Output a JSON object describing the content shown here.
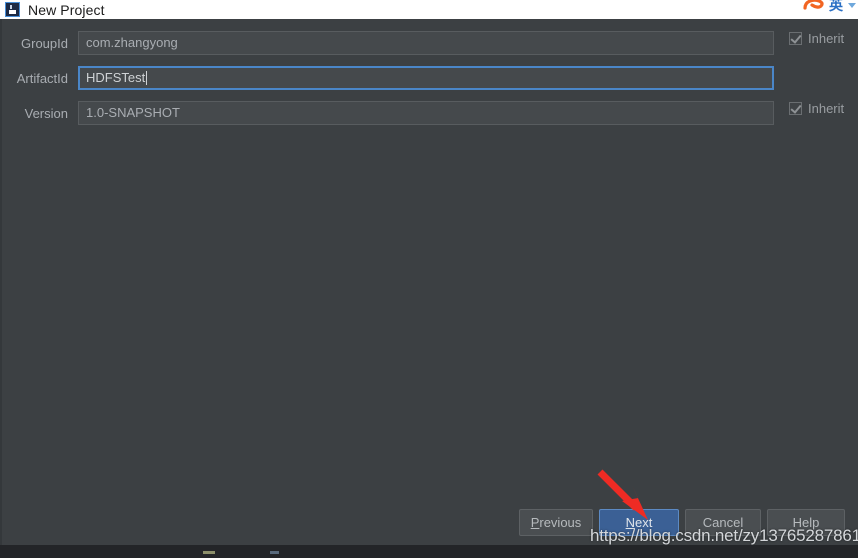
{
  "window": {
    "title": "New Project",
    "icon": "idea-app-icon"
  },
  "ime": {
    "logo_icon": "sogou-logo-icon",
    "mode_label": "英",
    "caret_icon": "chevron-down-icon"
  },
  "form": {
    "fields": [
      {
        "label": "GroupId",
        "value": "com.zhangyong",
        "placeholder": "",
        "focused": false,
        "inherit": {
          "label": "Inherit",
          "checked": true,
          "enabled": false
        }
      },
      {
        "label": "ArtifactId",
        "value": "HDFSTest",
        "placeholder": "",
        "focused": true,
        "inherit": null
      },
      {
        "label": "Version",
        "value": "1.0-SNAPSHOT",
        "placeholder": "",
        "focused": false,
        "inherit": {
          "label": "Inherit",
          "checked": true,
          "enabled": false
        }
      }
    ]
  },
  "buttons": {
    "previous": {
      "label": "Previous",
      "mnemonic": "P",
      "default": false
    },
    "next": {
      "label": "Next",
      "mnemonic": "N",
      "default": true
    },
    "cancel": {
      "label": "Cancel",
      "mnemonic": "C",
      "default": false
    },
    "help": {
      "label": "Help",
      "mnemonic": "H",
      "default": false
    }
  },
  "annotation": {
    "arrow_color": "#ee2b24",
    "arrow_target": "next-button"
  },
  "watermark": {
    "text": "https://blog.csdn.net/zy13765287861"
  },
  "colors": {
    "dialog_background": "#3c4043",
    "titlebar_background": "#ffffff",
    "field_background": "#45494c",
    "focus_border": "#4a86c8",
    "default_button": "#3b6095",
    "accent_red": "#ee2b24"
  }
}
